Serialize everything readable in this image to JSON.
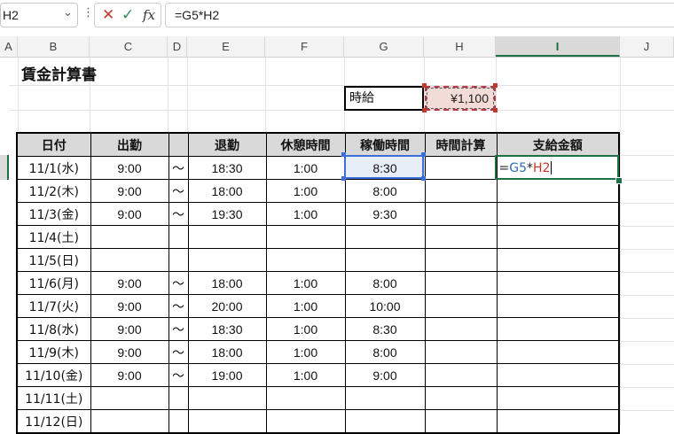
{
  "namebox": {
    "value": "H2",
    "dropdown_icon": "chevron-down-icon"
  },
  "formula_bar": {
    "more_icon": "vertical-dots-icon",
    "cancel_icon": "cancel-x-icon",
    "enter_icon": "checkmark-icon",
    "fx_label": "fx",
    "formula": "=G5*H2"
  },
  "columns": [
    "A",
    "B",
    "C",
    "D",
    "E",
    "F",
    "G",
    "H",
    "I",
    "J"
  ],
  "active_column": "I",
  "title": "賃金計算書",
  "hourly_rate": {
    "label": "時給",
    "value": "¥1,100"
  },
  "table": {
    "headers": [
      "日付",
      "出勤",
      "",
      "退勤",
      "休憩時間",
      "稼働時間",
      "時間計算",
      "支給金額"
    ],
    "rows": [
      {
        "date": "11/1(水)",
        "start": "9:00",
        "tilde": "〜",
        "end": "18:30",
        "break": "1:00",
        "work": "8:30",
        "calc": "",
        "pay": ""
      },
      {
        "date": "11/2(木)",
        "start": "9:00",
        "tilde": "〜",
        "end": "18:00",
        "break": "1:00",
        "work": "8:00",
        "calc": "",
        "pay": ""
      },
      {
        "date": "11/3(金)",
        "start": "9:00",
        "tilde": "〜",
        "end": "19:30",
        "break": "1:00",
        "work": "9:30",
        "calc": "",
        "pay": ""
      },
      {
        "date": "11/4(土)",
        "start": "",
        "tilde": "",
        "end": "",
        "break": "",
        "work": "",
        "calc": "",
        "pay": ""
      },
      {
        "date": "11/5(日)",
        "start": "",
        "tilde": "",
        "end": "",
        "break": "",
        "work": "",
        "calc": "",
        "pay": ""
      },
      {
        "date": "11/6(月)",
        "start": "9:00",
        "tilde": "〜",
        "end": "18:00",
        "break": "1:00",
        "work": "8:00",
        "calc": "",
        "pay": ""
      },
      {
        "date": "11/7(火)",
        "start": "9:00",
        "tilde": "〜",
        "end": "20:00",
        "break": "1:00",
        "work": "10:00",
        "calc": "",
        "pay": ""
      },
      {
        "date": "11/8(水)",
        "start": "9:00",
        "tilde": "〜",
        "end": "18:30",
        "break": "1:00",
        "work": "8:30",
        "calc": "",
        "pay": ""
      },
      {
        "date": "11/9(木)",
        "start": "9:00",
        "tilde": "〜",
        "end": "18:00",
        "break": "1:00",
        "work": "8:00",
        "calc": "",
        "pay": ""
      },
      {
        "date": "11/10(金)",
        "start": "9:00",
        "tilde": "〜",
        "end": "19:00",
        "break": "1:00",
        "work": "9:00",
        "calc": "",
        "pay": ""
      },
      {
        "date": "11/11(土)",
        "start": "",
        "tilde": "",
        "end": "",
        "break": "",
        "work": "",
        "calc": "",
        "pay": ""
      },
      {
        "date": "11/12(日)",
        "start": "",
        "tilde": "",
        "end": "",
        "break": "",
        "work": "",
        "calc": "",
        "pay": ""
      }
    ]
  },
  "editing_cell": {
    "eq": "=",
    "ref1": "G5",
    "op": "*",
    "ref2": "H2"
  },
  "colors": {
    "excel_green": "#1e7145",
    "ref_blue": "#3a6fd8",
    "ref_red": "#c0392b",
    "header_gray": "#d9d9d9",
    "rate_fill": "#f3dcd7"
  }
}
